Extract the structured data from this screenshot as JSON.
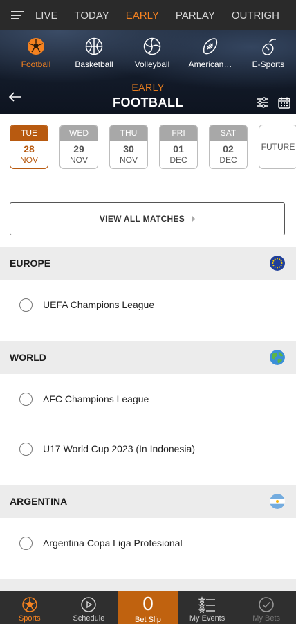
{
  "topnav": {
    "items": [
      {
        "label": "LIVE",
        "active": false
      },
      {
        "label": "TODAY",
        "active": false
      },
      {
        "label": "EARLY",
        "active": true
      },
      {
        "label": "PARLAY",
        "active": false
      },
      {
        "label": "OUTRIGH",
        "active": false
      }
    ]
  },
  "sports": [
    {
      "label": "Football",
      "icon": "football-icon",
      "active": true
    },
    {
      "label": "Basketball",
      "icon": "basketball-icon",
      "active": false
    },
    {
      "label": "Volleyball",
      "icon": "volleyball-icon",
      "active": false
    },
    {
      "label": "American…",
      "icon": "american-football-icon",
      "active": false
    },
    {
      "label": "E-Sports",
      "icon": "e-sports-icon",
      "active": false
    }
  ],
  "hero": {
    "subtitle": "EARLY",
    "title": "FOOTBALL"
  },
  "dates": [
    {
      "dow": "TUE",
      "day": "28",
      "mon": "NOV",
      "active": true
    },
    {
      "dow": "WED",
      "day": "29",
      "mon": "NOV",
      "active": false
    },
    {
      "dow": "THU",
      "day": "30",
      "mon": "NOV",
      "active": false
    },
    {
      "dow": "FRI",
      "day": "01",
      "mon": "DEC",
      "active": false
    },
    {
      "dow": "SAT",
      "day": "02",
      "mon": "DEC",
      "active": false
    }
  ],
  "future_label": "FUTURE",
  "view_all_label": "VIEW ALL MATCHES",
  "regions": [
    {
      "name": "EUROPE",
      "flag": "eu-flag-icon",
      "leagues": [
        "UEFA Champions League"
      ]
    },
    {
      "name": "WORLD",
      "flag": "globe-icon",
      "leagues": [
        "AFC Champions League",
        "U17 World Cup 2023 (In Indonesia)"
      ]
    },
    {
      "name": "ARGENTINA",
      "flag": "argentina-flag-icon",
      "leagues": [
        "Argentina Copa Liga Profesional"
      ]
    }
  ],
  "bottombar": {
    "sports_label": "Sports",
    "schedule_label": "Schedule",
    "betslip_count": "0",
    "betslip_label": "Bet Slip",
    "myevents_label": "My Events",
    "mybets_label": "My Bets"
  },
  "colors": {
    "accent": "#f58220",
    "accent_dark": "#b85a10",
    "nav_bg": "#2a2a2a",
    "region_bg": "#ececec"
  }
}
